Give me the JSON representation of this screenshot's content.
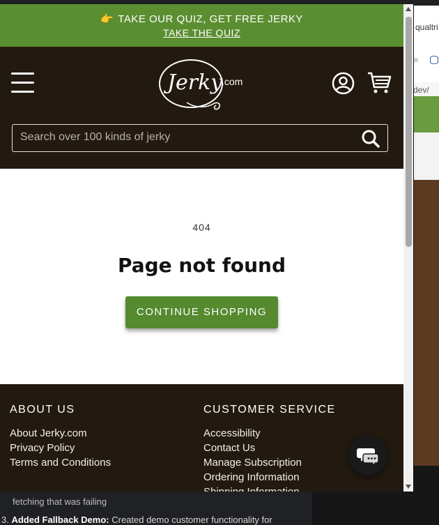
{
  "announcement": {
    "emoji": "👉",
    "text": "TAKE OUR QUIZ, GET FREE JERKY",
    "link": "TAKE THE QUIZ"
  },
  "header": {
    "logo_text": "Jerky",
    "logo_suffix": ".com",
    "search_placeholder": "Search over 100 kinds of jerky"
  },
  "main": {
    "code": "404",
    "title": "Page not found",
    "button": "CONTINUE SHOPPING"
  },
  "footer": {
    "about": {
      "heading": "ABOUT US",
      "links": [
        "About Jerky.com",
        "Privacy Policy",
        "Terms and Conditions"
      ]
    },
    "service": {
      "heading": "CUSTOMER SERVICE",
      "links": [
        "Accessibility",
        "Contact Us",
        "Manage Subscription",
        "Ordering Information",
        "Shipping Information"
      ]
    }
  },
  "background": {
    "right_fragment_1": "qualtri",
    "right_fragment_x": "×",
    "right_fragment_2": "dev/",
    "bottom_line_1": "fetching that was failing",
    "bottom_line_2_prefix": "3. ",
    "bottom_line_2_bold": "Added Fallback Demo:",
    "bottom_line_2_rest": " Created demo customer functionality for"
  },
  "colors": {
    "announce_green": "#5b8e31",
    "header_dark": "#221a10",
    "button_green": "#558a2f"
  }
}
